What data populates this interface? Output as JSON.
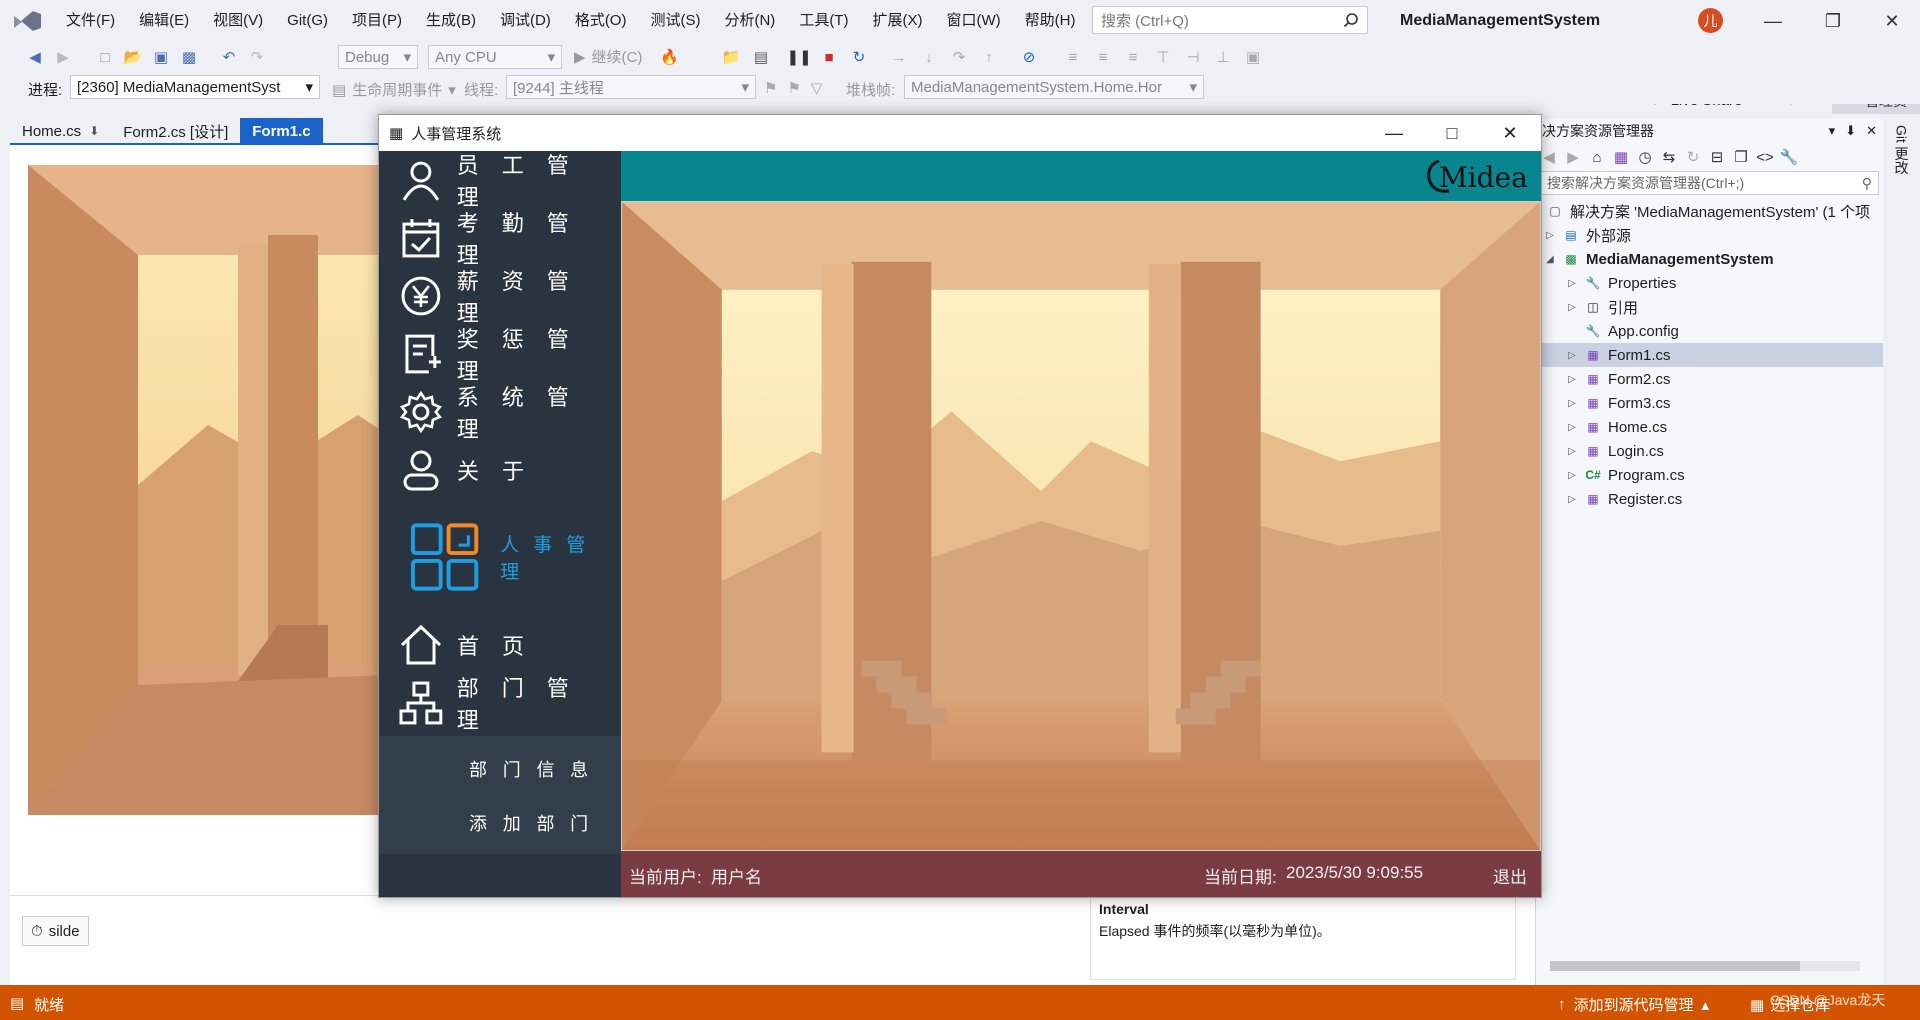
{
  "ide": {
    "menu": [
      "文件(F)",
      "编辑(E)",
      "视图(V)",
      "Git(G)",
      "项目(P)",
      "生成(B)",
      "调试(D)",
      "格式(O)",
      "测试(S)",
      "分析(N)",
      "工具(T)",
      "扩展(X)",
      "窗口(W)",
      "帮助(H)"
    ],
    "search_placeholder": "搜索 (Ctrl+Q)",
    "solution_title": "MediaManagementSystem",
    "avatar_text": "儿",
    "toolbar": {
      "config": "Debug",
      "platform": "Any CPU",
      "continue_label": "继续(C)",
      "live_share": "Live Share",
      "admin_label": "管理员"
    },
    "debug_bar": {
      "process_label": "进程:",
      "process_value": "[2360] MediaManagementSyst",
      "lifecycle_label": "生命周期事件",
      "thread_label": "线程:",
      "thread_value": "[9244] 主线程",
      "stack_label": "堆栈帧:",
      "stack_value": "MediaManagementSystem.Home.Hor"
    },
    "tabs": [
      "Home.cs",
      "Form2.cs [设计]",
      "Form1.c"
    ],
    "component_tray": {
      "timer_name": "silde"
    },
    "properties_desc": {
      "title": "Interval",
      "text": "Elapsed 事件的频率(以毫秒为单位)。"
    },
    "solution_explorer": {
      "header": "决方案资源管理器",
      "search_placeholder": "搜索解决方案资源管理器(Ctrl+;)",
      "solution_node": "解决方案 'MediaManagementSystem' (1 个项",
      "external": "外部源",
      "project": "MediaManagementSystem",
      "items": [
        "Properties",
        "引用",
        "App.config",
        "Form1.cs",
        "Form2.cs",
        "Form3.cs",
        "Home.cs",
        "Login.cs",
        "Program.cs",
        "Register.cs"
      ]
    },
    "git_side_label": "Git 更改",
    "status": {
      "ready": "就绪",
      "add_source": "添加到源代码管理",
      "repo": "选择仓库",
      "watermark": "CSDN @Java龙天"
    }
  },
  "app": {
    "title": "人事管理系统",
    "brand": "Midea",
    "nav": [
      "员 工 管 理",
      "考 勤 管 理",
      "薪 资 管 理",
      "奖 惩 管 理",
      "系 统 管 理",
      "关  于"
    ],
    "hr_label": "人 事 管 理",
    "nav2": [
      "首  页",
      "部 门 管 理"
    ],
    "dept_sub": [
      "部 门 信 息",
      "添 加 部 门"
    ],
    "footer": {
      "user_label": "当前用户:",
      "user_value": "用户名",
      "date_label": "当前日期:",
      "date_value": "2023/5/30 9:09:55",
      "exit": "退出"
    }
  },
  "colors": {
    "sidebar": "#2a3440",
    "header": "#07868f",
    "footer": "#7b3b43",
    "statusbar": "#d35400",
    "accent": "#1e9ee0"
  }
}
